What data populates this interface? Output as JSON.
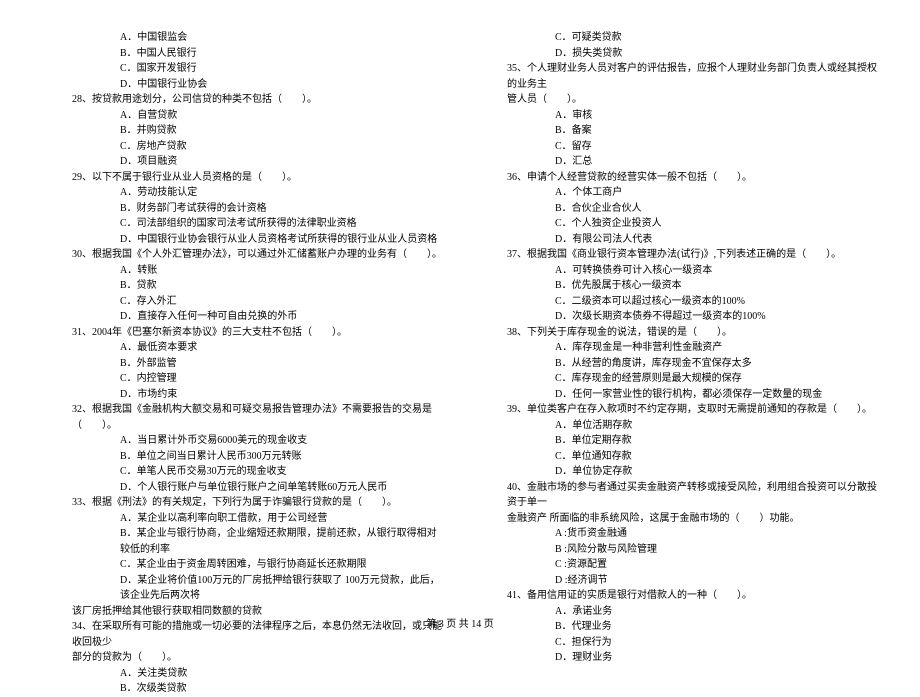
{
  "left": {
    "opts27": [
      "A．中国银监会",
      "B．中国人民银行",
      "C．国家开发银行",
      "D．中国银行业协会"
    ],
    "q28": "28、按贷款用途划分，公司信贷的种类不包括（　　）。",
    "opts28": [
      "A．自营贷款",
      "B．并购贷款",
      "C．房地产贷款",
      "D．项目融资"
    ],
    "q29": "29、以下不属于银行业从业人员资格的是（　　）。",
    "opts29": [
      "A．劳动技能认定",
      "B．财务部门考试获得的会计资格",
      "C．司法部组织的国家司法考试所获得的法律职业资格",
      "D．中国银行业协会银行从业人员资格考试所获得的银行业从业人员资格"
    ],
    "q30": "30、根据我国《个人外汇管理办法》，可以通过外汇储蓄账户办理的业务有（　　）。",
    "opts30": [
      "A．转账",
      "B．贷款",
      "C．存入外汇",
      "D．直接存入任何一种可自由兑换的外币"
    ],
    "q31": "31、2004年《巴塞尔新资本协议》的三大支柱不包括（　　）。",
    "opts31": [
      "A．最低资本要求",
      "B．外部监管",
      "C．内控管理",
      "D．市场约束"
    ],
    "q32": "32、根据我国《金融机构大额交易和可疑交易报告管理办法》不需要报告的交易是（　　）。",
    "opts32": [
      "A．当日累计外币交易6000美元的现金收支",
      "B．单位之间当日累计人民币300万元转账",
      "C．单笔人民币交易30万元的现金收支",
      "D．个人银行账户与单位银行账户之间单笔转账60万元人民币"
    ],
    "q33": "33、根据《刑法》的有关规定，下列行为属于诈骗银行贷款的是（　　）。",
    "opts33": [
      "A．某企业以高利率向职工借款，用于公司经营",
      "B．某企业与银行协商，企业缩短还款期限，提前还款，从银行取得相对较低的利率",
      "C．某企业由于资金周转困难，与银行协商延长还款期限",
      "D．某企业将价值100万元的厂房抵押给银行获取了 100万元贷款，此后，该企业先后两次将"
    ],
    "q33cont": "该厂房抵押给其他银行获取相同数额的贷款",
    "q34": "34、在采取所有可能的措施或一切必要的法律程序之后，本息仍然无法收回，或只能收回极少",
    "q34cont": "部分的贷款为（　　）。",
    "opts34": [
      "A．关注类贷款",
      "B．次级类贷款"
    ]
  },
  "right": {
    "opts34b": [
      "C．可疑类贷款",
      "D．损失类贷款"
    ],
    "q35": "35、个人理财业务人员对客户的评估报告，应报个人理财业务部门负责人或经其授权的业务主",
    "q35cont": "管人员（　　）。",
    "opts35": [
      "A．审核",
      "B．备案",
      "C．留存",
      "D．汇总"
    ],
    "q36": "36、申请个人经营贷款的经营实体一般不包括（　　）。",
    "opts36": [
      "A．个体工商户",
      "B．合伙企业合伙人",
      "C．个人独资企业投资人",
      "D．有限公司法人代表"
    ],
    "q37": "37、根据我国《商业银行资本管理办法(试行)》,下列表述正确的是（　　）。",
    "opts37": [
      "A．可转换债券可计入核心一级资本",
      "B．优先股属于核心一级资本",
      "C．二级资本可以超过核心一级资本的100%",
      "D．次级长期资本债券不得超过一级资本的100%"
    ],
    "q38": "38、下列关于库存现金的说法，错误的是（　　）。",
    "opts38": [
      "A．库存现金是一种非营利性金融资产",
      "B．从经营的角度讲，库存现金不宜保存太多",
      "C．库存现金的经营原则是最大规模的保存",
      "D．任何一家营业性的银行机构，都必须保存一定数量的现金"
    ],
    "q39": "39、单位类客户在存入款项时不约定存期，支取时无需提前通知的存款是（　　）。",
    "opts39": [
      "A．单位活期存款",
      "B．单位定期存款",
      "C．单位通知存款",
      "D．单位协定存款"
    ],
    "q40": "40、金融市场的参与者通过买卖金融资产转移或接受风险，利用组合投资可以分散投资于单一",
    "q40cont": "金融资产 所面临的非系统风险，这属于金融市场的（　　）功能。",
    "opts40": [
      "A :货币资金融通",
      "B :风险分散与风险管理",
      "C :资源配置",
      "D :经济调节"
    ],
    "q41": "41、备用信用证的实质是银行对借款人的一种（　　）。",
    "opts41": [
      "A．承诺业务",
      "B．代理业务",
      "C．担保行为",
      "D．理财业务"
    ]
  },
  "footer": "第 3 页 共 14 页"
}
